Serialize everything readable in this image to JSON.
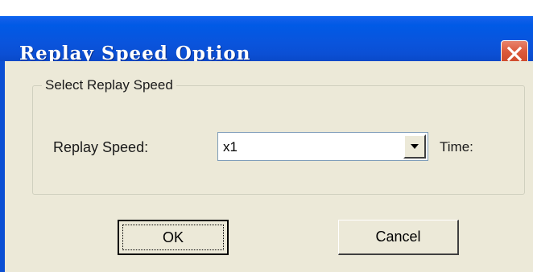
{
  "window": {
    "title": "Replay Speed Option",
    "close_icon": "close-icon"
  },
  "group": {
    "legend": "Select Replay Speed"
  },
  "replay_speed": {
    "label": "Replay Speed:",
    "selected_value": "x1",
    "dropdown_icon": "chevron-down-icon"
  },
  "time": {
    "label": "Time:"
  },
  "buttons": {
    "ok_label": "OK",
    "cancel_label": "Cancel"
  },
  "colors": {
    "titlebar": "#0054e3",
    "dialog_bg": "#ece9d8",
    "close_button": "#dc5a3c"
  }
}
